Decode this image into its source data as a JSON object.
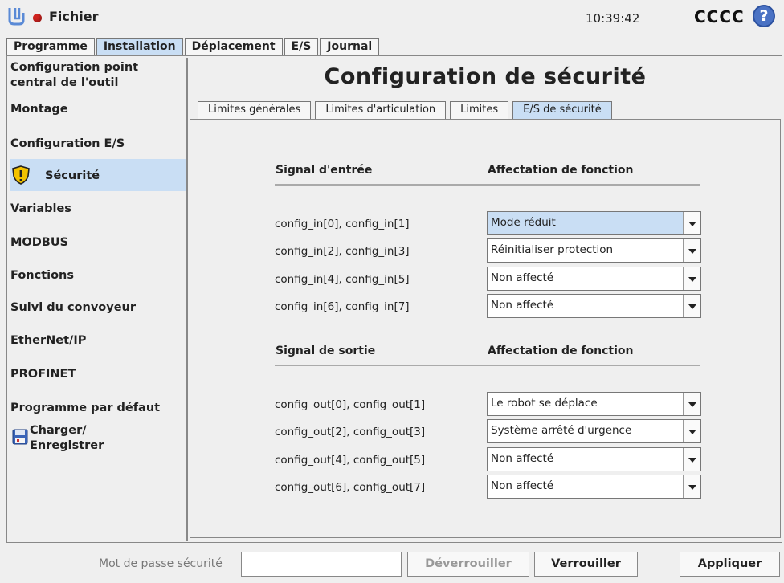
{
  "titlebar": {
    "file_menu": "Fichier",
    "clock": "10:39:42",
    "robot_name": "CCCC",
    "help": "?",
    "status_color": "#d0231f"
  },
  "main_tabs": [
    "Programme",
    "Installation",
    "Déplacement",
    "E/S",
    "Journal"
  ],
  "active_main_tab": "Installation",
  "sidebar": {
    "items": [
      "Configuration point central de l'outil",
      "Montage",
      "Configuration E/S",
      "Sécurité",
      "Variables",
      "MODBUS",
      "Fonctions",
      "Suivi du convoyeur",
      "EtherNet/IP",
      "PROFINET",
      "Programme par défaut",
      "Charger/ Enregistrer"
    ],
    "active": "Sécurité"
  },
  "page_title": "Configuration de sécurité",
  "sub_tabs": [
    "Limites générales",
    "Limites d'articulation",
    "Limites",
    "E/S de sécurité"
  ],
  "active_sub_tab": "E/S de sécurité",
  "inputs": {
    "signal_header": "Signal d'entrée",
    "function_header": "Affectation de fonction",
    "rows": [
      {
        "signal": "config_in[0], config_in[1]",
        "value": "Mode réduit"
      },
      {
        "signal": "config_in[2], config_in[3]",
        "value": "Réinitialiser protection"
      },
      {
        "signal": "config_in[4], config_in[5]",
        "value": "Non affecté"
      },
      {
        "signal": "config_in[6], config_in[7]",
        "value": "Non affecté"
      }
    ]
  },
  "outputs": {
    "signal_header": "Signal de sortie",
    "function_header": "Affectation de fonction",
    "rows": [
      {
        "signal": "config_out[0], config_out[1]",
        "value": "Le robot se déplace"
      },
      {
        "signal": "config_out[2], config_out[3]",
        "value": "Système arrêté d'urgence"
      },
      {
        "signal": "config_out[4], config_out[5]",
        "value": "Non affecté"
      },
      {
        "signal": "config_out[6], config_out[7]",
        "value": "Non affecté"
      }
    ]
  },
  "footer": {
    "password_label": "Mot de passe sécurité",
    "password_value": "",
    "unlock": "Déverrouiller",
    "lock": "Verrouiller",
    "apply": "Appliquer"
  },
  "colors": {
    "highlight": "#c9def4",
    "warning": "#f2c200",
    "help": "#4a72c4"
  }
}
